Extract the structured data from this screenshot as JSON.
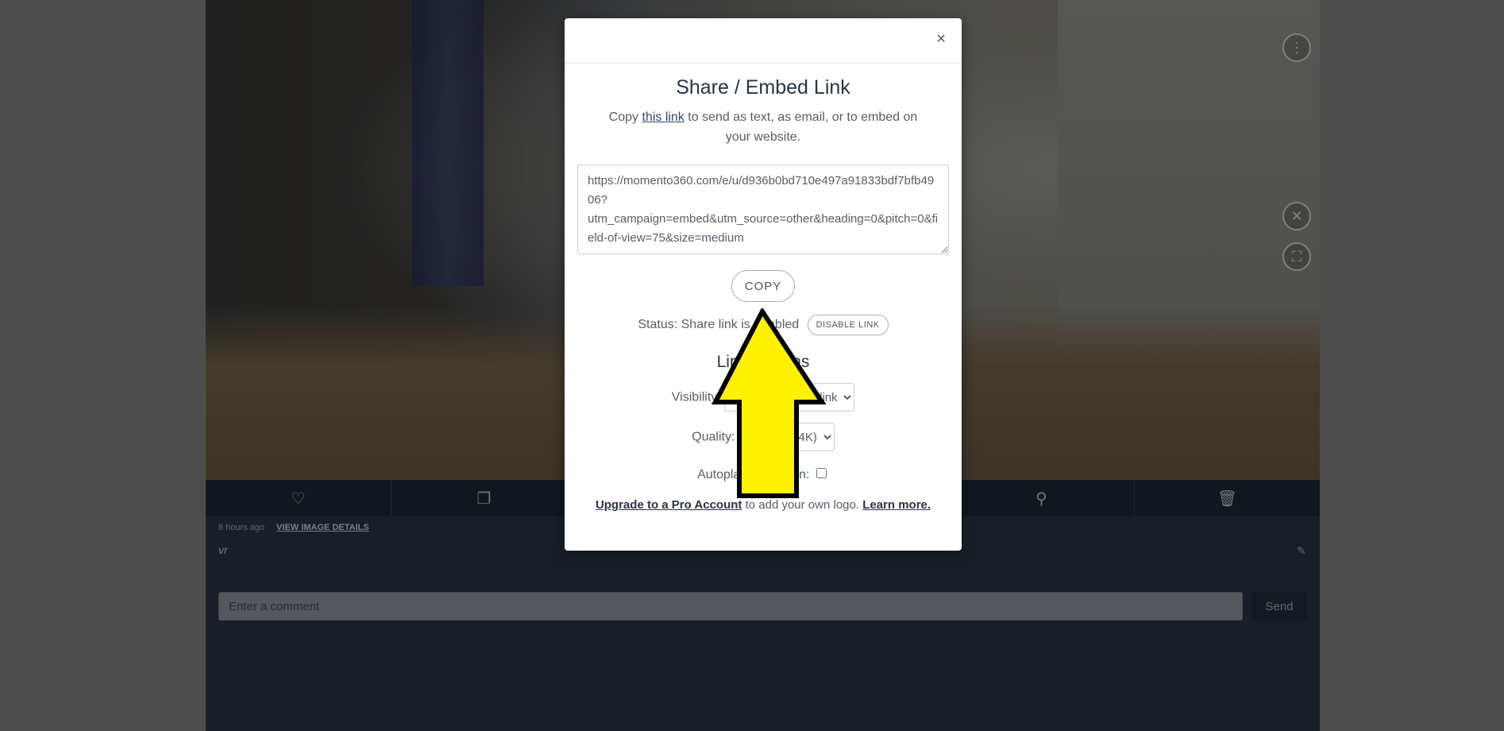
{
  "viewer": {
    "icons": [
      "more-icon",
      "close-circle-icon",
      "fullscreen-icon"
    ]
  },
  "action_bar": {
    "icons": [
      "heart-icon",
      "duplicate-icon",
      "location-pin-icon",
      "trash-icon"
    ]
  },
  "meta": {
    "timestamp": "8 hours ago",
    "details_link": "VIEW IMAGE DETAILS",
    "caption": "vr"
  },
  "comment": {
    "placeholder": "Enter a comment",
    "send_label": "Send"
  },
  "modal": {
    "close_label": "×",
    "title": "Share / Embed Link",
    "desc_prefix": "Copy",
    "desc_link": "this link",
    "desc_suffix": "to send as text, as email, or to embed on your website.",
    "url": "https://momento360.com/e/u/d936b0bd710e497a91833bdf7bfb4906?utm_campaign=embed&utm_source=other&heading=0&pitch=0&field-of-view=75&size=medium",
    "copy_label": "COPY",
    "status_text": "Status: Share link is enabled",
    "disable_label": "DISABLE LINK",
    "options_title": "Link Options",
    "visibility_label": "Visibility:",
    "visibility_value": "Anyone with the link",
    "quality_label": "Quality:",
    "quality_value": "Ultra HD (4K)",
    "autoplay_label": "Autoplay Animation:",
    "upgrade_link": "Upgrade to a Pro Account",
    "upgrade_middle": "to add your own logo.",
    "learn_more": "Learn more."
  },
  "annotation": {
    "arrow_color": "#fff200",
    "outline_color": "#000000"
  }
}
